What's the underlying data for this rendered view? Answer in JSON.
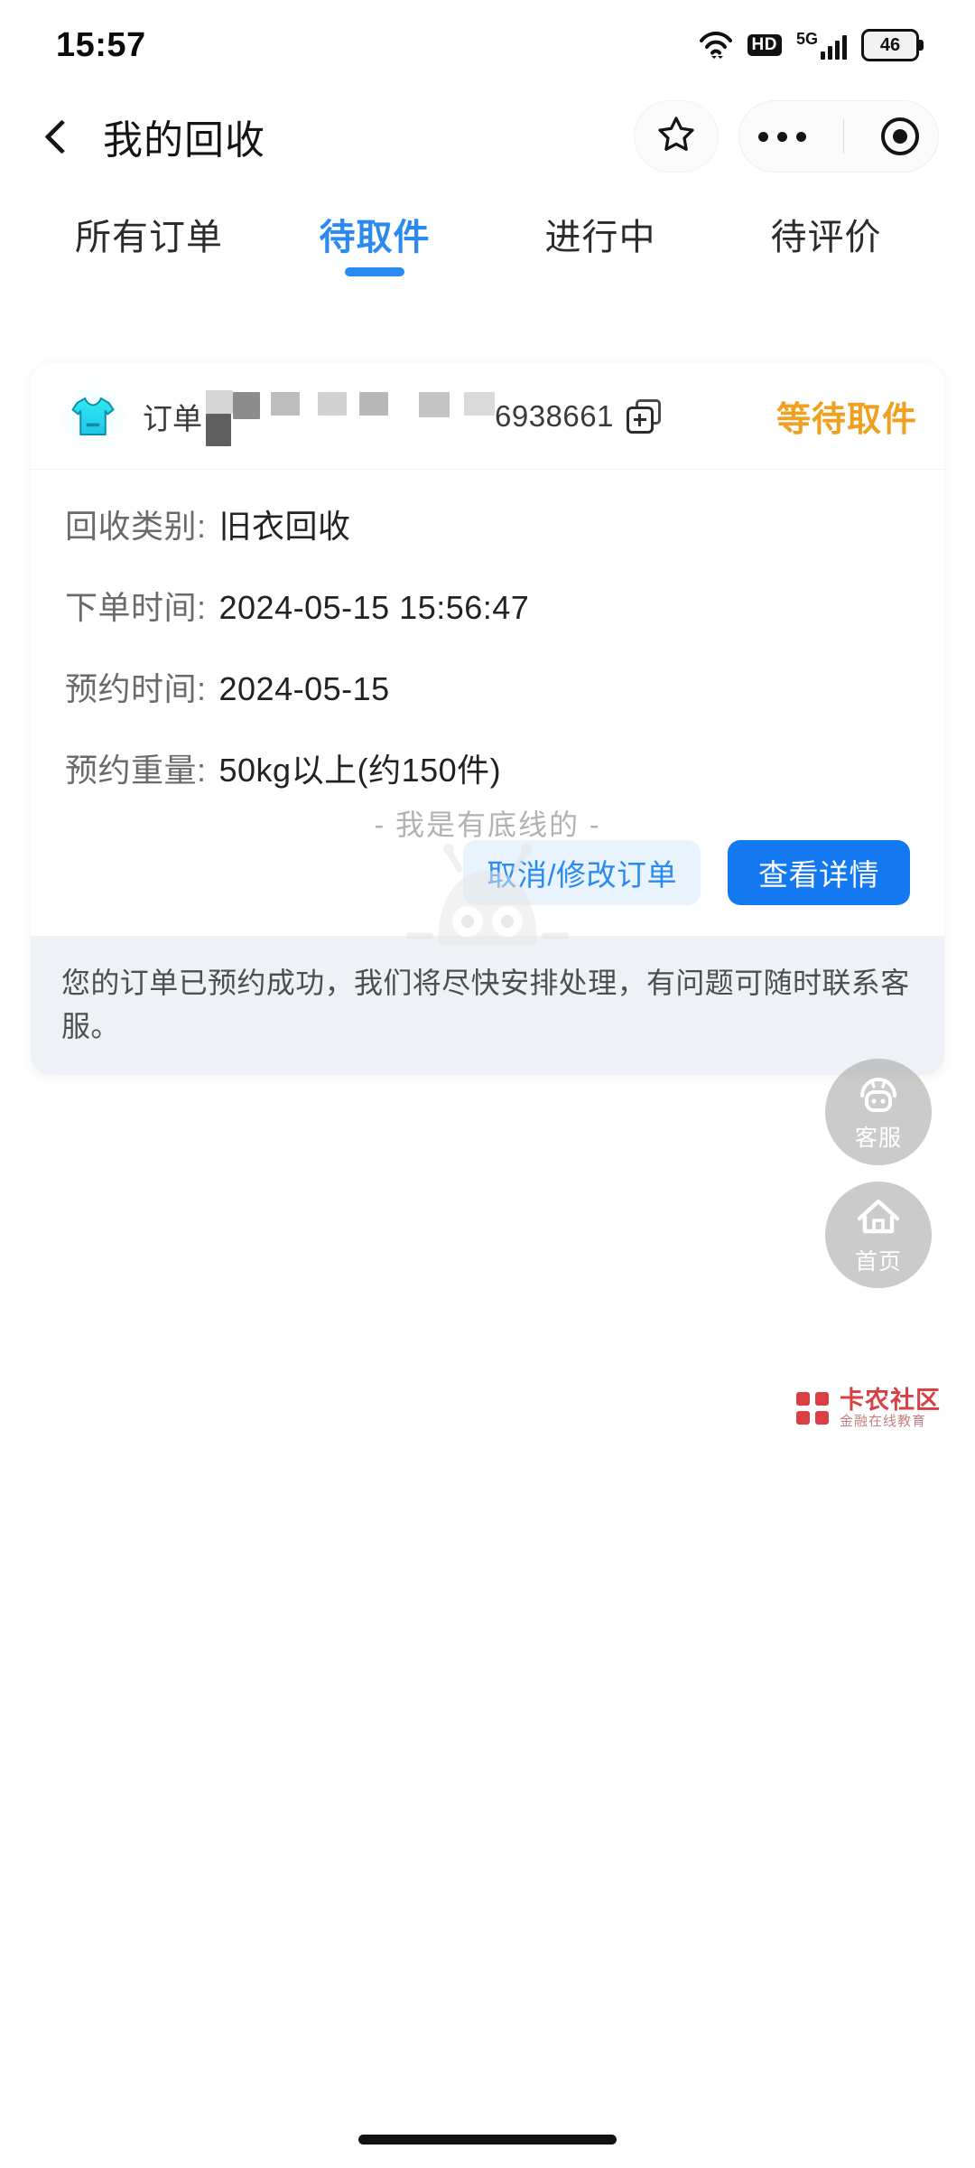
{
  "status_bar": {
    "time": "15:57",
    "wifi_icon": "wifi-icon",
    "hd_label": "HD",
    "network_label": "5G",
    "battery_level": "46"
  },
  "header": {
    "back_icon": "back-chevron-icon",
    "title": "我的回收",
    "star_icon": "star-icon",
    "more_icon": "more-dots-icon",
    "target_icon": "target-dot-icon"
  },
  "tabs": [
    {
      "label": "所有订单",
      "active": false
    },
    {
      "label": "待取件",
      "active": true
    },
    {
      "label": "进行中",
      "active": false
    },
    {
      "label": "待评价",
      "active": false
    }
  ],
  "order_card": {
    "category_icon": "tshirt-icon",
    "order_label": "订单",
    "order_number_visible": "6938661",
    "order_number_redacted": true,
    "copy_icon": "copy-icon",
    "status": "等待取件",
    "status_color": "#f0a020",
    "details": [
      {
        "key": "回收类别:",
        "value": "旧衣回收"
      },
      {
        "key": "下单时间:",
        "value": "2024-05-15 15:56:47"
      },
      {
        "key": "预约时间:",
        "value": "2024-05-15"
      },
      {
        "key": "预约重量:",
        "value": "50kg以上(约150件)"
      }
    ],
    "buttons": {
      "secondary": "取消/修改订单",
      "primary": "查看详情"
    },
    "note": "您的订单已预约成功，我们将尽快安排处理，有问题可随时联系客服。"
  },
  "list_end": {
    "text": "- 我是有底线的 -",
    "mascot_icon": "robot-mascot-icon"
  },
  "floating_buttons": [
    {
      "label": "客服",
      "icon": "headset-robot-icon"
    },
    {
      "label": "首页",
      "icon": "home-icon"
    }
  ],
  "watermark": {
    "mark_icon": "kanong-logo-icon",
    "title": "卡农社区",
    "subtitle": "金融在线教育"
  },
  "theme": {
    "accent_blue": "#2a8af0",
    "primary_button": "#1478f0",
    "secondary_button_bg": "#e9f3fd",
    "status_orange": "#f0a020",
    "page_bg": "#ffffff",
    "note_bg": "#eef1f5"
  }
}
